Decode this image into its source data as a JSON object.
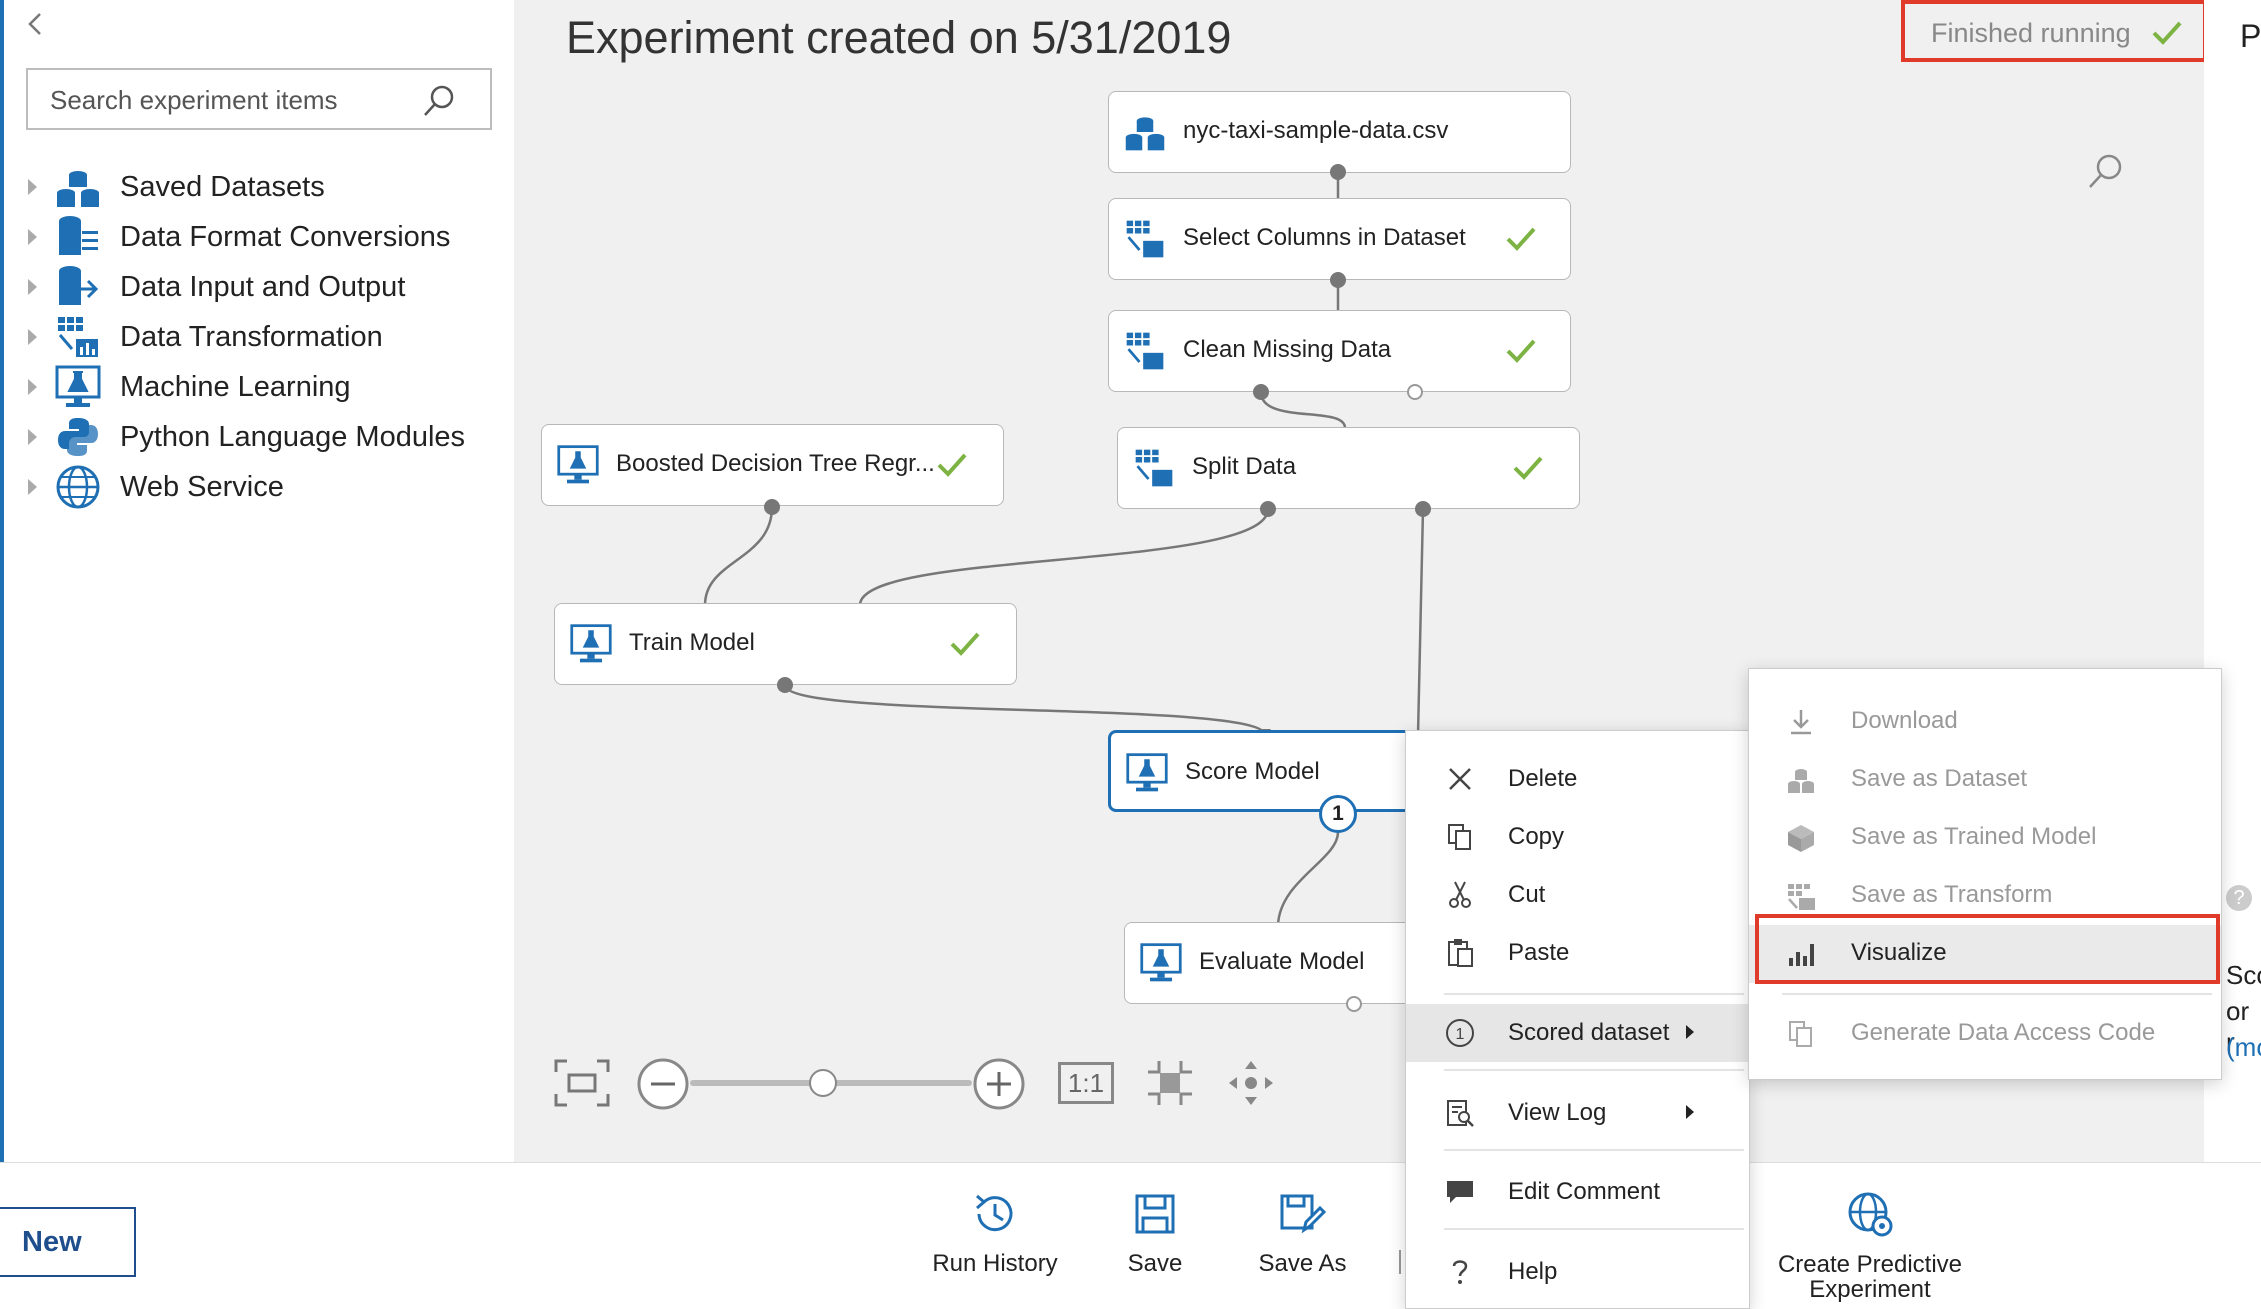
{
  "palette": {
    "search_placeholder": "Search experiment items",
    "categories": [
      {
        "label": "Saved Datasets",
        "icon": "datasets-icon"
      },
      {
        "label": "Data Format Conversions",
        "icon": "format-conversion-icon"
      },
      {
        "label": "Data Input and Output",
        "icon": "data-io-icon"
      },
      {
        "label": "Data Transformation",
        "icon": "transformation-icon"
      },
      {
        "label": "Machine Learning",
        "icon": "machine-learning-icon"
      },
      {
        "label": "Python Language Modules",
        "icon": "python-icon"
      },
      {
        "label": "Web Service",
        "icon": "globe-icon"
      }
    ]
  },
  "experiment": {
    "title": "Experiment created on 5/31/2019",
    "status": "Finished running",
    "right_edge_text": "P",
    "right_edge_lines": [
      "Sco",
      "or r",
      "(mo"
    ],
    "help_glyph": "?"
  },
  "nodes": [
    {
      "label": "nyc-taxi-sample-data.csv",
      "checked": false
    },
    {
      "label": "Select Columns in Dataset",
      "checked": true
    },
    {
      "label": "Clean Missing Data",
      "checked": true
    },
    {
      "label": "Split Data",
      "checked": true
    },
    {
      "label": "Boosted Decision Tree Regr...",
      "checked": true
    },
    {
      "label": "Train Model",
      "checked": true
    },
    {
      "label": "Score Model",
      "checked": false
    },
    {
      "label": "Evaluate Model",
      "checked": false
    }
  ],
  "output_port_badge": "1",
  "zoom": {
    "reset_label": "1:1",
    "level": 0.47
  },
  "context_menu": {
    "items": [
      {
        "label": "Delete",
        "icon": "delete-icon"
      },
      {
        "label": "Copy",
        "icon": "copy-icon"
      },
      {
        "label": "Cut",
        "icon": "cut-icon"
      },
      {
        "label": "Paste",
        "icon": "paste-icon"
      },
      {
        "label": "Scored dataset",
        "icon": "port-1-icon",
        "submenu": true
      },
      {
        "label": "View Log",
        "icon": "view-log-icon",
        "submenu": true
      },
      {
        "label": "Edit Comment",
        "icon": "comment-icon"
      },
      {
        "label": "Help",
        "icon": "help-icon"
      }
    ],
    "port_number": "1"
  },
  "submenu": {
    "items": [
      {
        "label": "Download",
        "enabled": false
      },
      {
        "label": "Save as Dataset",
        "enabled": false
      },
      {
        "label": "Save as Trained Model",
        "enabled": false
      },
      {
        "label": "Save as Transform",
        "enabled": false
      },
      {
        "label": "Visualize",
        "enabled": true
      },
      {
        "label": "Generate Data Access Code",
        "enabled": false
      }
    ]
  },
  "toolbar": {
    "new": "New",
    "run_history": "Run History",
    "save": "Save",
    "save_as": "Save As",
    "create_predictive": "Create Predictive Experiment"
  },
  "colors": {
    "accent": "#1f6fb4",
    "highlight_box": "#e03a2a",
    "check": "#7cb342",
    "canvas": "#f0f0f0"
  }
}
